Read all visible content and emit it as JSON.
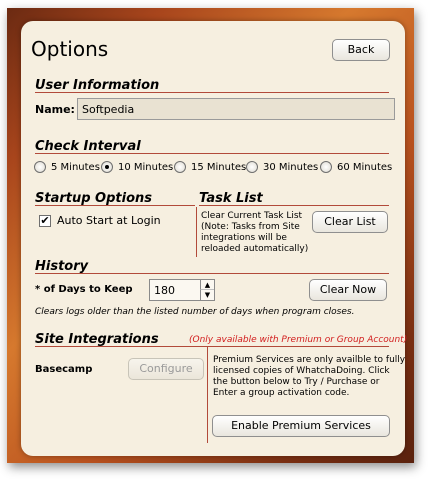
{
  "header": {
    "title": "Options",
    "back_label": "Back"
  },
  "user_info": {
    "heading": "User Information",
    "name_label": "Name:",
    "name_value": "Softpedia"
  },
  "check_interval": {
    "heading": "Check Interval",
    "options": [
      "5 Minutes",
      "10 Minutes",
      "15 Minutes",
      "30 Minutes",
      "60 Minutes"
    ],
    "selected": "10 Minutes"
  },
  "startup": {
    "heading": "Startup Options",
    "auto_start_label": "Auto Start at Login",
    "auto_start_checked": true
  },
  "task_list": {
    "heading": "Task List",
    "desc_lines": [
      "Clear Current Task List",
      "(Note: Tasks from Site",
      "integrations will be",
      "reloaded automatically)"
    ],
    "clear_list_label": "Clear List"
  },
  "history": {
    "heading": "History",
    "days_label": "* of Days to Keep",
    "days_value": "180",
    "clear_now_label": "Clear Now",
    "note": "Clears logs older than the listed number of days when program closes."
  },
  "site_integrations": {
    "heading": "Site Integrations",
    "availability_note": "(Only available with Premium or Group Account)",
    "service_name": "Basecamp",
    "configure_label": "Configure",
    "premium_lines": [
      "Premium Services are only availble to fully",
      "licensed copies of WhatchaDoing.  Click",
      "the button below to Try / Purchase or",
      "Enter a group activation code."
    ],
    "enable_label": "Enable Premium Services"
  },
  "colors": {
    "accent_rule": "#b24a3a",
    "note_red": "#d21e1e"
  }
}
